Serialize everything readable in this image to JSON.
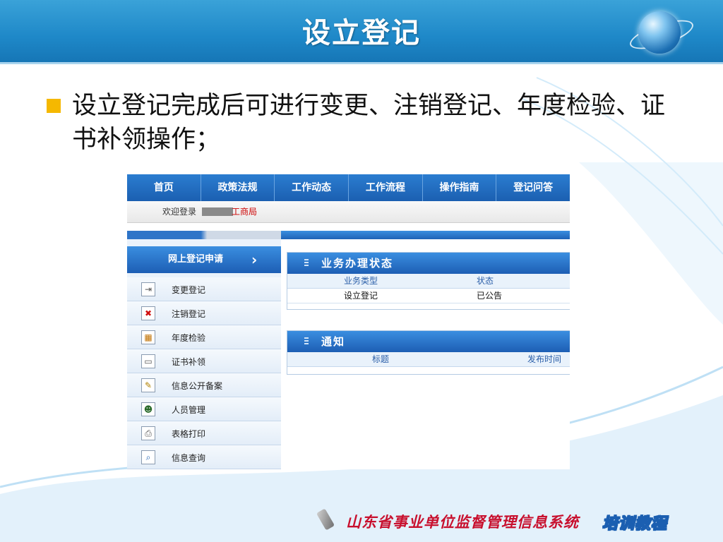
{
  "slide": {
    "title": "设立登记",
    "bullet": "设立登记完成后可进行变更、注销登记、年度检验、证书补领操作；"
  },
  "screenshot": {
    "nav": [
      "首页",
      "政策法规",
      "工作动态",
      "工作流程",
      "操作指南",
      "登记问答"
    ],
    "welcome_label": "欢迎登录",
    "welcome_org": "工商局",
    "sidebar": {
      "header": "网上登记申请",
      "header_arrow": "›",
      "items": [
        {
          "label": "变更登记",
          "icon": "change-icon",
          "glyph": "⇥"
        },
        {
          "label": "注销登记",
          "icon": "cancel-icon",
          "glyph": "✖"
        },
        {
          "label": "年度检验",
          "icon": "calendar-person-icon",
          "glyph": "▦"
        },
        {
          "label": "证书补领",
          "icon": "certificate-icon",
          "glyph": "▭"
        },
        {
          "label": "信息公开备案",
          "icon": "edit-icon",
          "glyph": "✎"
        },
        {
          "label": "人员管理",
          "icon": "users-icon",
          "glyph": "☻"
        },
        {
          "label": "表格打印",
          "icon": "printer-icon",
          "glyph": "⎙"
        },
        {
          "label": "信息查询",
          "icon": "search-icon",
          "glyph": "⌕"
        }
      ]
    },
    "status_panel": {
      "title": "业务办理状态",
      "columns": [
        "业务类型",
        "状态"
      ],
      "rows": [
        [
          "设立登记",
          "已公告"
        ]
      ]
    },
    "notice_panel": {
      "title": "通知",
      "columns": [
        "标题",
        "发布时间"
      ]
    }
  },
  "footer": {
    "system_name": "山东省事业单位监督管理信息系统",
    "badge": "培训教程"
  },
  "colors": {
    "title_bar": "#1e88c8",
    "bullet": "#f5b800",
    "nav": "#1b5fb1",
    "footer_text": "#c8102e"
  }
}
